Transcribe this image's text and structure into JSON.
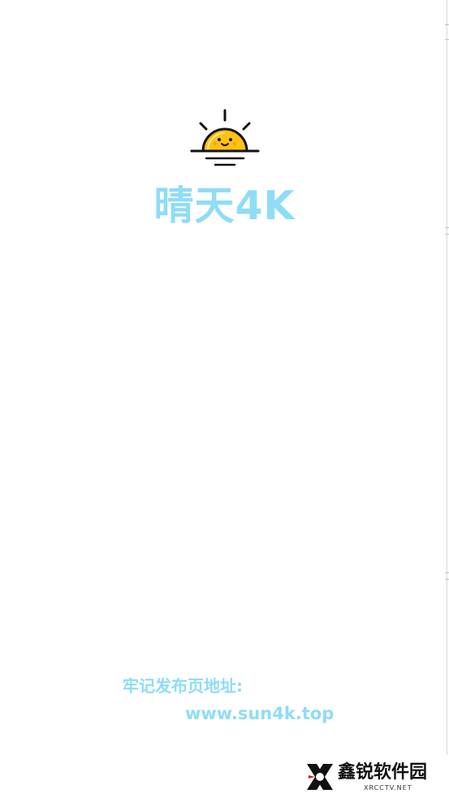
{
  "app": {
    "title": "晴天4K",
    "logo_icon": "sun-icon"
  },
  "footer": {
    "release_label": "牢记发布页地址:",
    "release_url": "www.sun4k.top"
  },
  "watermark": {
    "name": "鑫锐软件园",
    "domain": "XRCCTV.NET"
  },
  "colors": {
    "background": "#ffffff",
    "accent": "#8fdcf7",
    "sun_fill": "#ffc20e",
    "outline": "#111111"
  }
}
